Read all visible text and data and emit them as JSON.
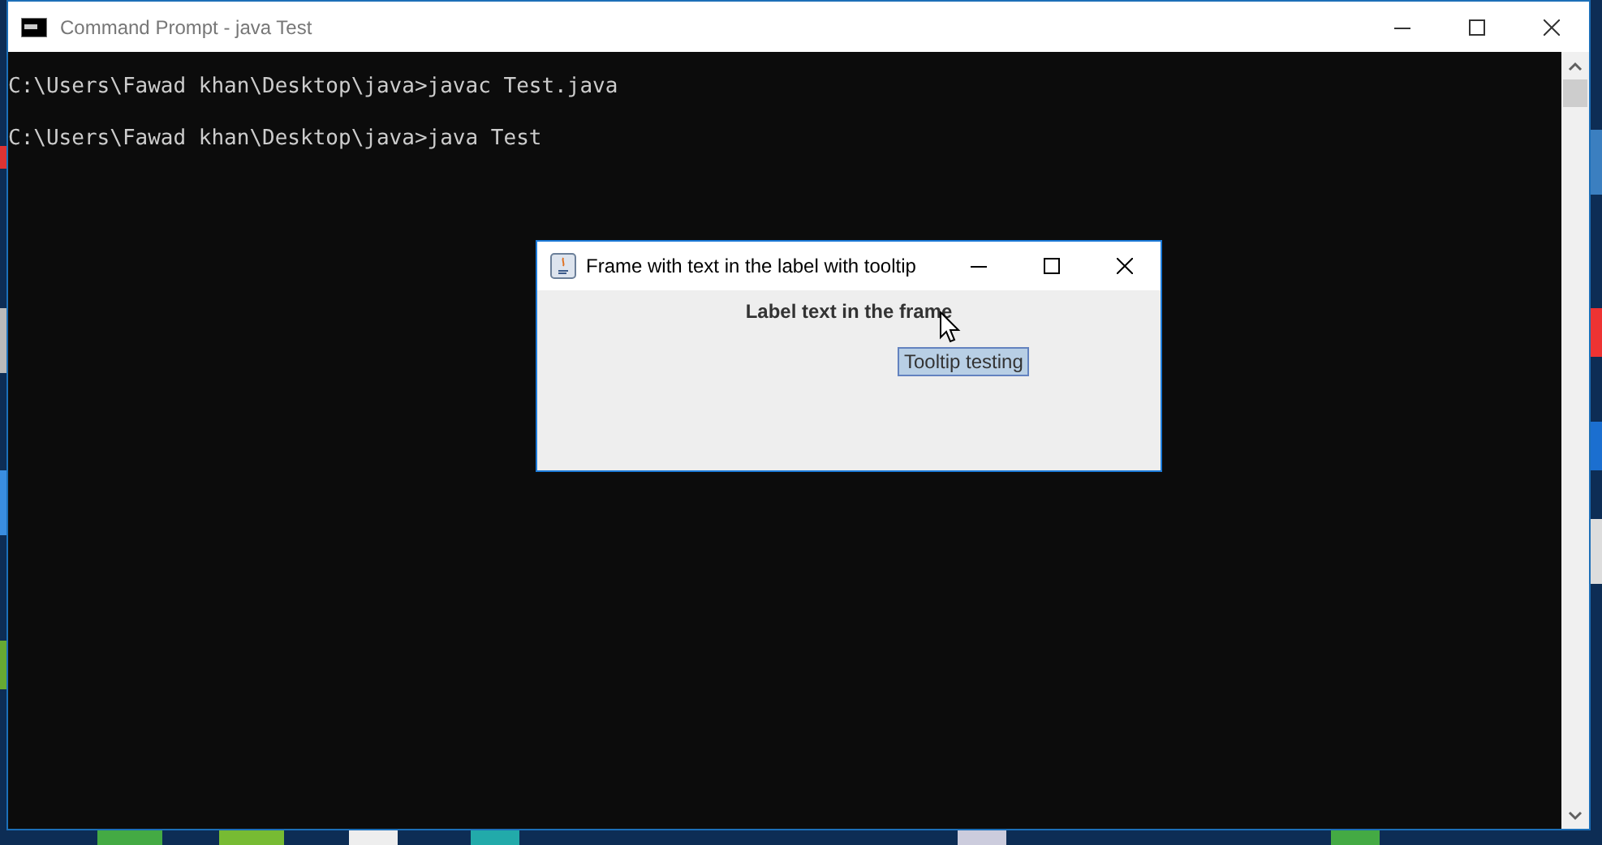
{
  "console_window": {
    "title": "Command Prompt - java  Test",
    "lines": [
      "C:\\Users\\Fawad khan\\Desktop\\java>javac Test.java",
      "C:\\Users\\Fawad khan\\Desktop\\java>java Test"
    ]
  },
  "java_frame": {
    "title": "Frame with text in the label with tooltip",
    "label": "Label text in the frame",
    "tooltip": "Tooltip testing"
  }
}
